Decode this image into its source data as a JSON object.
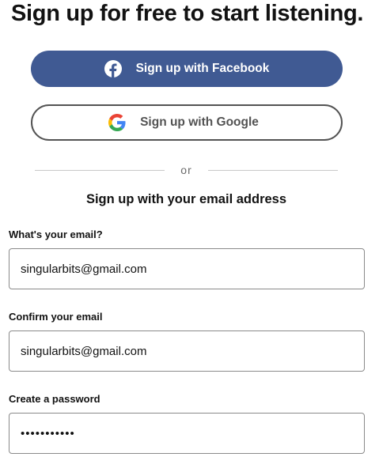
{
  "header": {
    "title": "Sign up for free to start listening."
  },
  "social": {
    "facebook_label": "Sign up with Facebook",
    "facebook_icon": "facebook-icon",
    "facebook_color": "#405a93",
    "google_label": "Sign up with Google",
    "google_icon": "google-icon"
  },
  "divider": {
    "text": "or"
  },
  "form": {
    "heading": "Sign up with your email address",
    "email_label": "What's your email?",
    "email_value": "singularbits@gmail.com",
    "confirm_label": "Confirm your email",
    "confirm_value": "singularbits@gmail.com",
    "password_label": "Create a password",
    "password_value": "•••••••••••"
  }
}
